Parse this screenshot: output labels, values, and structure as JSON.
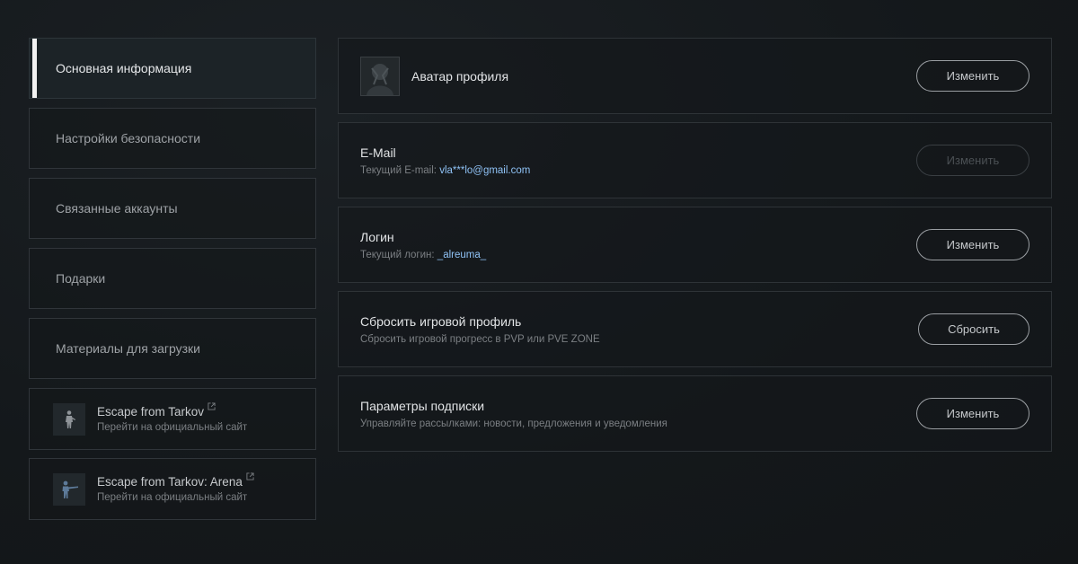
{
  "sidebar": {
    "items": [
      {
        "label": "Основная информация",
        "active": true
      },
      {
        "label": "Настройки безопасности",
        "active": false
      },
      {
        "label": "Связанные аккаунты",
        "active": false
      },
      {
        "label": "Подарки",
        "active": false
      },
      {
        "label": "Материалы для загрузки",
        "active": false
      }
    ],
    "external_links": [
      {
        "name": "Escape from Tarkov",
        "sub": "Перейти на официальный сайт",
        "icon": "tarkov-soldier-icon"
      },
      {
        "name": "Escape from Tarkov: Arena",
        "sub": "Перейти на официальный сайт",
        "icon": "arena-soldier-icon"
      }
    ]
  },
  "main": {
    "avatar": {
      "title": "Аватар профиля",
      "button": "Изменить"
    },
    "email": {
      "title": "E-Mail",
      "sub_label": "Текущий E-mail:",
      "value": "vla***lo@gmail.com",
      "button": "Изменить",
      "button_disabled": true
    },
    "login": {
      "title": "Логин",
      "sub_label": "Текущий логин:",
      "value": "_alreuma_",
      "button": "Изменить"
    },
    "reset": {
      "title": "Сбросить игровой профиль",
      "sub": "Сбросить игровой прогресс в PVP или PVE ZONE",
      "button": "Сбросить"
    },
    "subscription": {
      "title": "Параметры подписки",
      "sub": "Управляйте рассылками: новости, предложения и уведомления",
      "button": "Изменить"
    }
  },
  "colors": {
    "background": "#14181b",
    "accent_value": "#8fc2f5",
    "active_bar": "#f2f2f2"
  }
}
